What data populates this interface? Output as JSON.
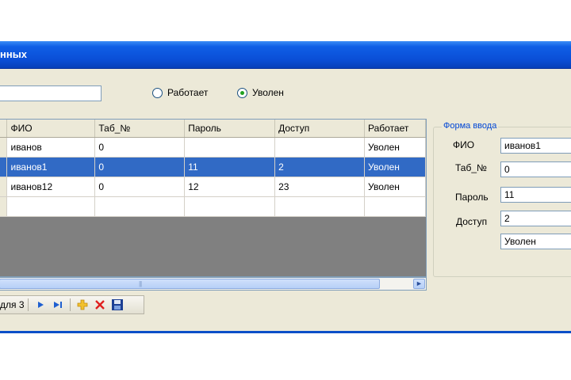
{
  "window": {
    "title": "нных"
  },
  "filters": {
    "search_value": "",
    "radio_working": "Работает",
    "radio_fired": "Уволен",
    "selected": "Уволен"
  },
  "grid": {
    "columns": [
      "ФИО",
      "Таб_№",
      "Пароль",
      "Доступ",
      "Работает"
    ],
    "rows": [
      [
        "иванов",
        "0",
        "",
        "",
        "Уволен"
      ],
      [
        "иванов1",
        "0",
        "11",
        "2",
        "Уволен"
      ],
      [
        "иванов12",
        "0",
        "12",
        "23",
        "Уволен"
      ],
      [
        "",
        "",
        "",
        "",
        ""
      ]
    ],
    "selected_row": 1
  },
  "navigator": {
    "position_text": "для 3"
  },
  "form": {
    "legend": "Форма ввода",
    "fio_label": "ФИО",
    "fio_value": "иванов1",
    "tab_label": "Таб_№",
    "tab_value": "0",
    "password_label": "Пароль",
    "password_value": "11",
    "access_label": "Доступ",
    "access_value": "2",
    "status_value": "Уволен"
  },
  "colors": {
    "titlebar": "#0a4ed6",
    "selection": "#316ac5",
    "window_bg": "#ece9d8",
    "legend": "#0046d5"
  }
}
